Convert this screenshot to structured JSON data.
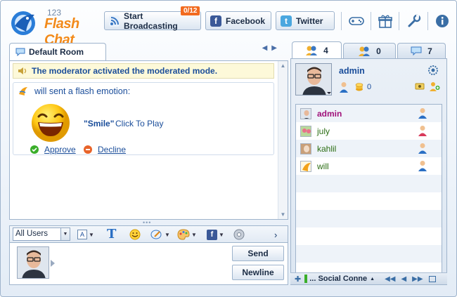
{
  "app": {
    "logo_number": "123",
    "logo_name": "Flash Chat"
  },
  "toolbar_top": {
    "broadcast_label": "Start Broadcasting",
    "broadcast_badge": "0/12",
    "facebook_label": "Facebook",
    "twitter_label": "Twitter"
  },
  "room": {
    "tab_label": "Default Room",
    "notice": "The moderator activated the moderated mode.",
    "emotion_line": "will sent a flash emotion:",
    "emotion_name": "\"Smile\"",
    "emotion_action": "Click To Play",
    "approve_label": "Approve",
    "decline_label": "Decline"
  },
  "input": {
    "recipient_select": "All Users",
    "font_button": "A",
    "send_label": "Send",
    "newline_label": "Newline"
  },
  "right_tabs": [
    {
      "icon": "users-icon",
      "count": "4"
    },
    {
      "icon": "rooms-icon",
      "count": "0"
    },
    {
      "icon": "chat-bubble-icon",
      "count": "7"
    }
  ],
  "me": {
    "name": "admin",
    "coins": "0"
  },
  "users": [
    {
      "name": "admin",
      "color": "#a0117a",
      "bold": true,
      "role": "male"
    },
    {
      "name": "july",
      "color": "#2c6e14",
      "bold": false,
      "role": "female"
    },
    {
      "name": "kahlil",
      "color": "#2c6e14",
      "bold": false,
      "role": "male"
    },
    {
      "name": "will",
      "color": "#2c6e14",
      "bold": false,
      "role": "male"
    }
  ],
  "footer": {
    "module_label": "... Social Conne"
  },
  "colors": {
    "accent": "#1a4d9a",
    "logo_orange": "#f28a1a",
    "badge": "#f26b1f"
  }
}
